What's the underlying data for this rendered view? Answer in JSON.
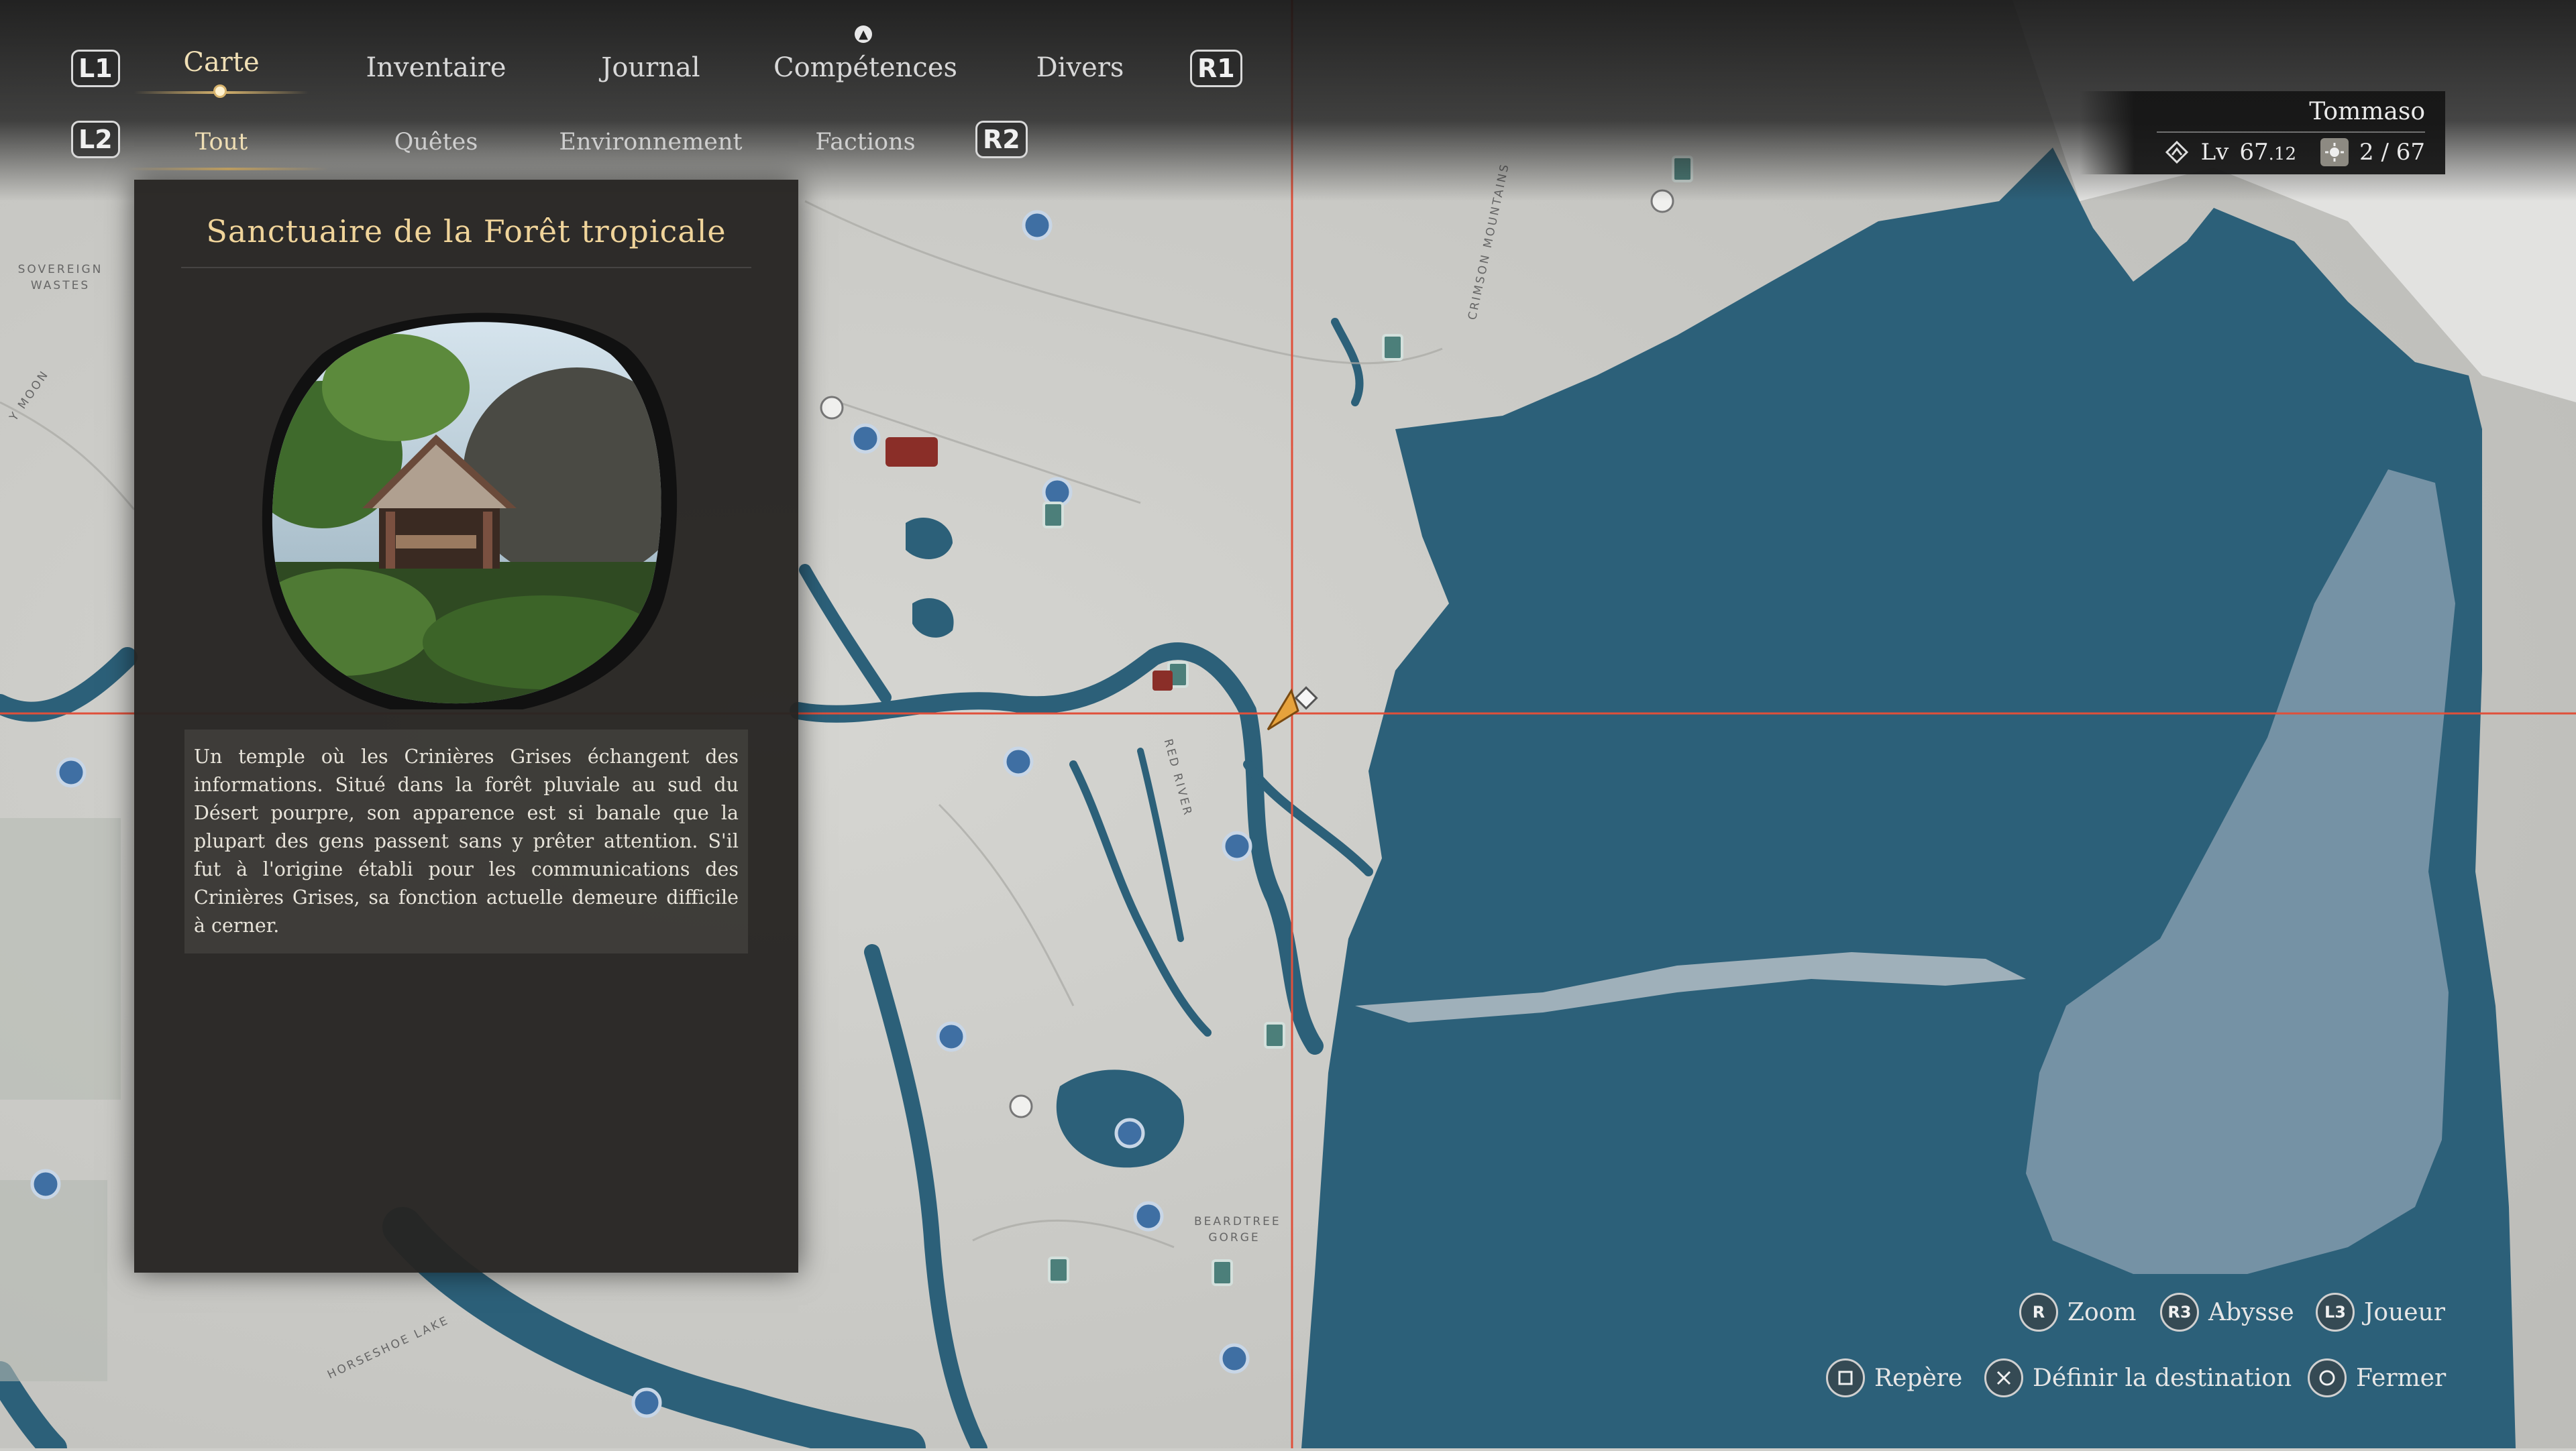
{
  "nav": {
    "left_shoulder": "L1",
    "right_shoulder": "R1",
    "tabs": [
      {
        "label": "Carte",
        "active": true
      },
      {
        "label": "Inventaire",
        "active": false
      },
      {
        "label": "Journal",
        "active": false
      },
      {
        "label": "Compétences",
        "active": false
      },
      {
        "label": "Divers",
        "active": false
      }
    ],
    "sub_left_shoulder": "L2",
    "sub_right_shoulder": "R2",
    "subtabs": [
      {
        "label": "Tout",
        "active": true
      },
      {
        "label": "Quêtes",
        "active": false
      },
      {
        "label": "Environnement",
        "active": false
      },
      {
        "label": "Factions",
        "active": false
      }
    ]
  },
  "player": {
    "name": "Tommaso",
    "level_prefix": "Lv",
    "level": "67",
    "level_decimal": ".12",
    "collect_count": "2",
    "collect_sep": "/",
    "collect_total": "67"
  },
  "info_panel": {
    "title": "Sanctuaire de la Forêt tropicale",
    "description": "Un temple où les Crinières Grises échangent des informations. Situé dans la forêt pluviale au sud du Désert pourpre, son apparence est si banale que la plupart des gens passent sans y prêter attention. S'il fut à l'origine établi pour les communications des Crinières Grises, sa fonction actuelle demeure difficile à cerner."
  },
  "map_labels": {
    "sovereign_wastes": "SOVEREIGN WASTES",
    "moon": "Y MOON",
    "crimson_mountains": "CRIMSON MOUNTAINS",
    "red_river": "RED RIVER",
    "beardtree_gorge": "BEARDTREE GORGE",
    "horseshoe_lake": "HORSESHOE LAKE"
  },
  "controls": {
    "zoom_button": "R",
    "zoom_label": "Zoom",
    "abyss_button": "R3",
    "abyss_label": "Abysse",
    "player_button": "L3",
    "player_label": "Joueur",
    "marker_label": "Repère",
    "destination_label": "Définir la destination",
    "close_label": "Fermer"
  },
  "colors": {
    "water": "#2c6079",
    "land": "#cfd0cc",
    "accent_gold": "#f0d49a",
    "crosshair": "#e0503a",
    "player_marker": "#e6a23c"
  }
}
